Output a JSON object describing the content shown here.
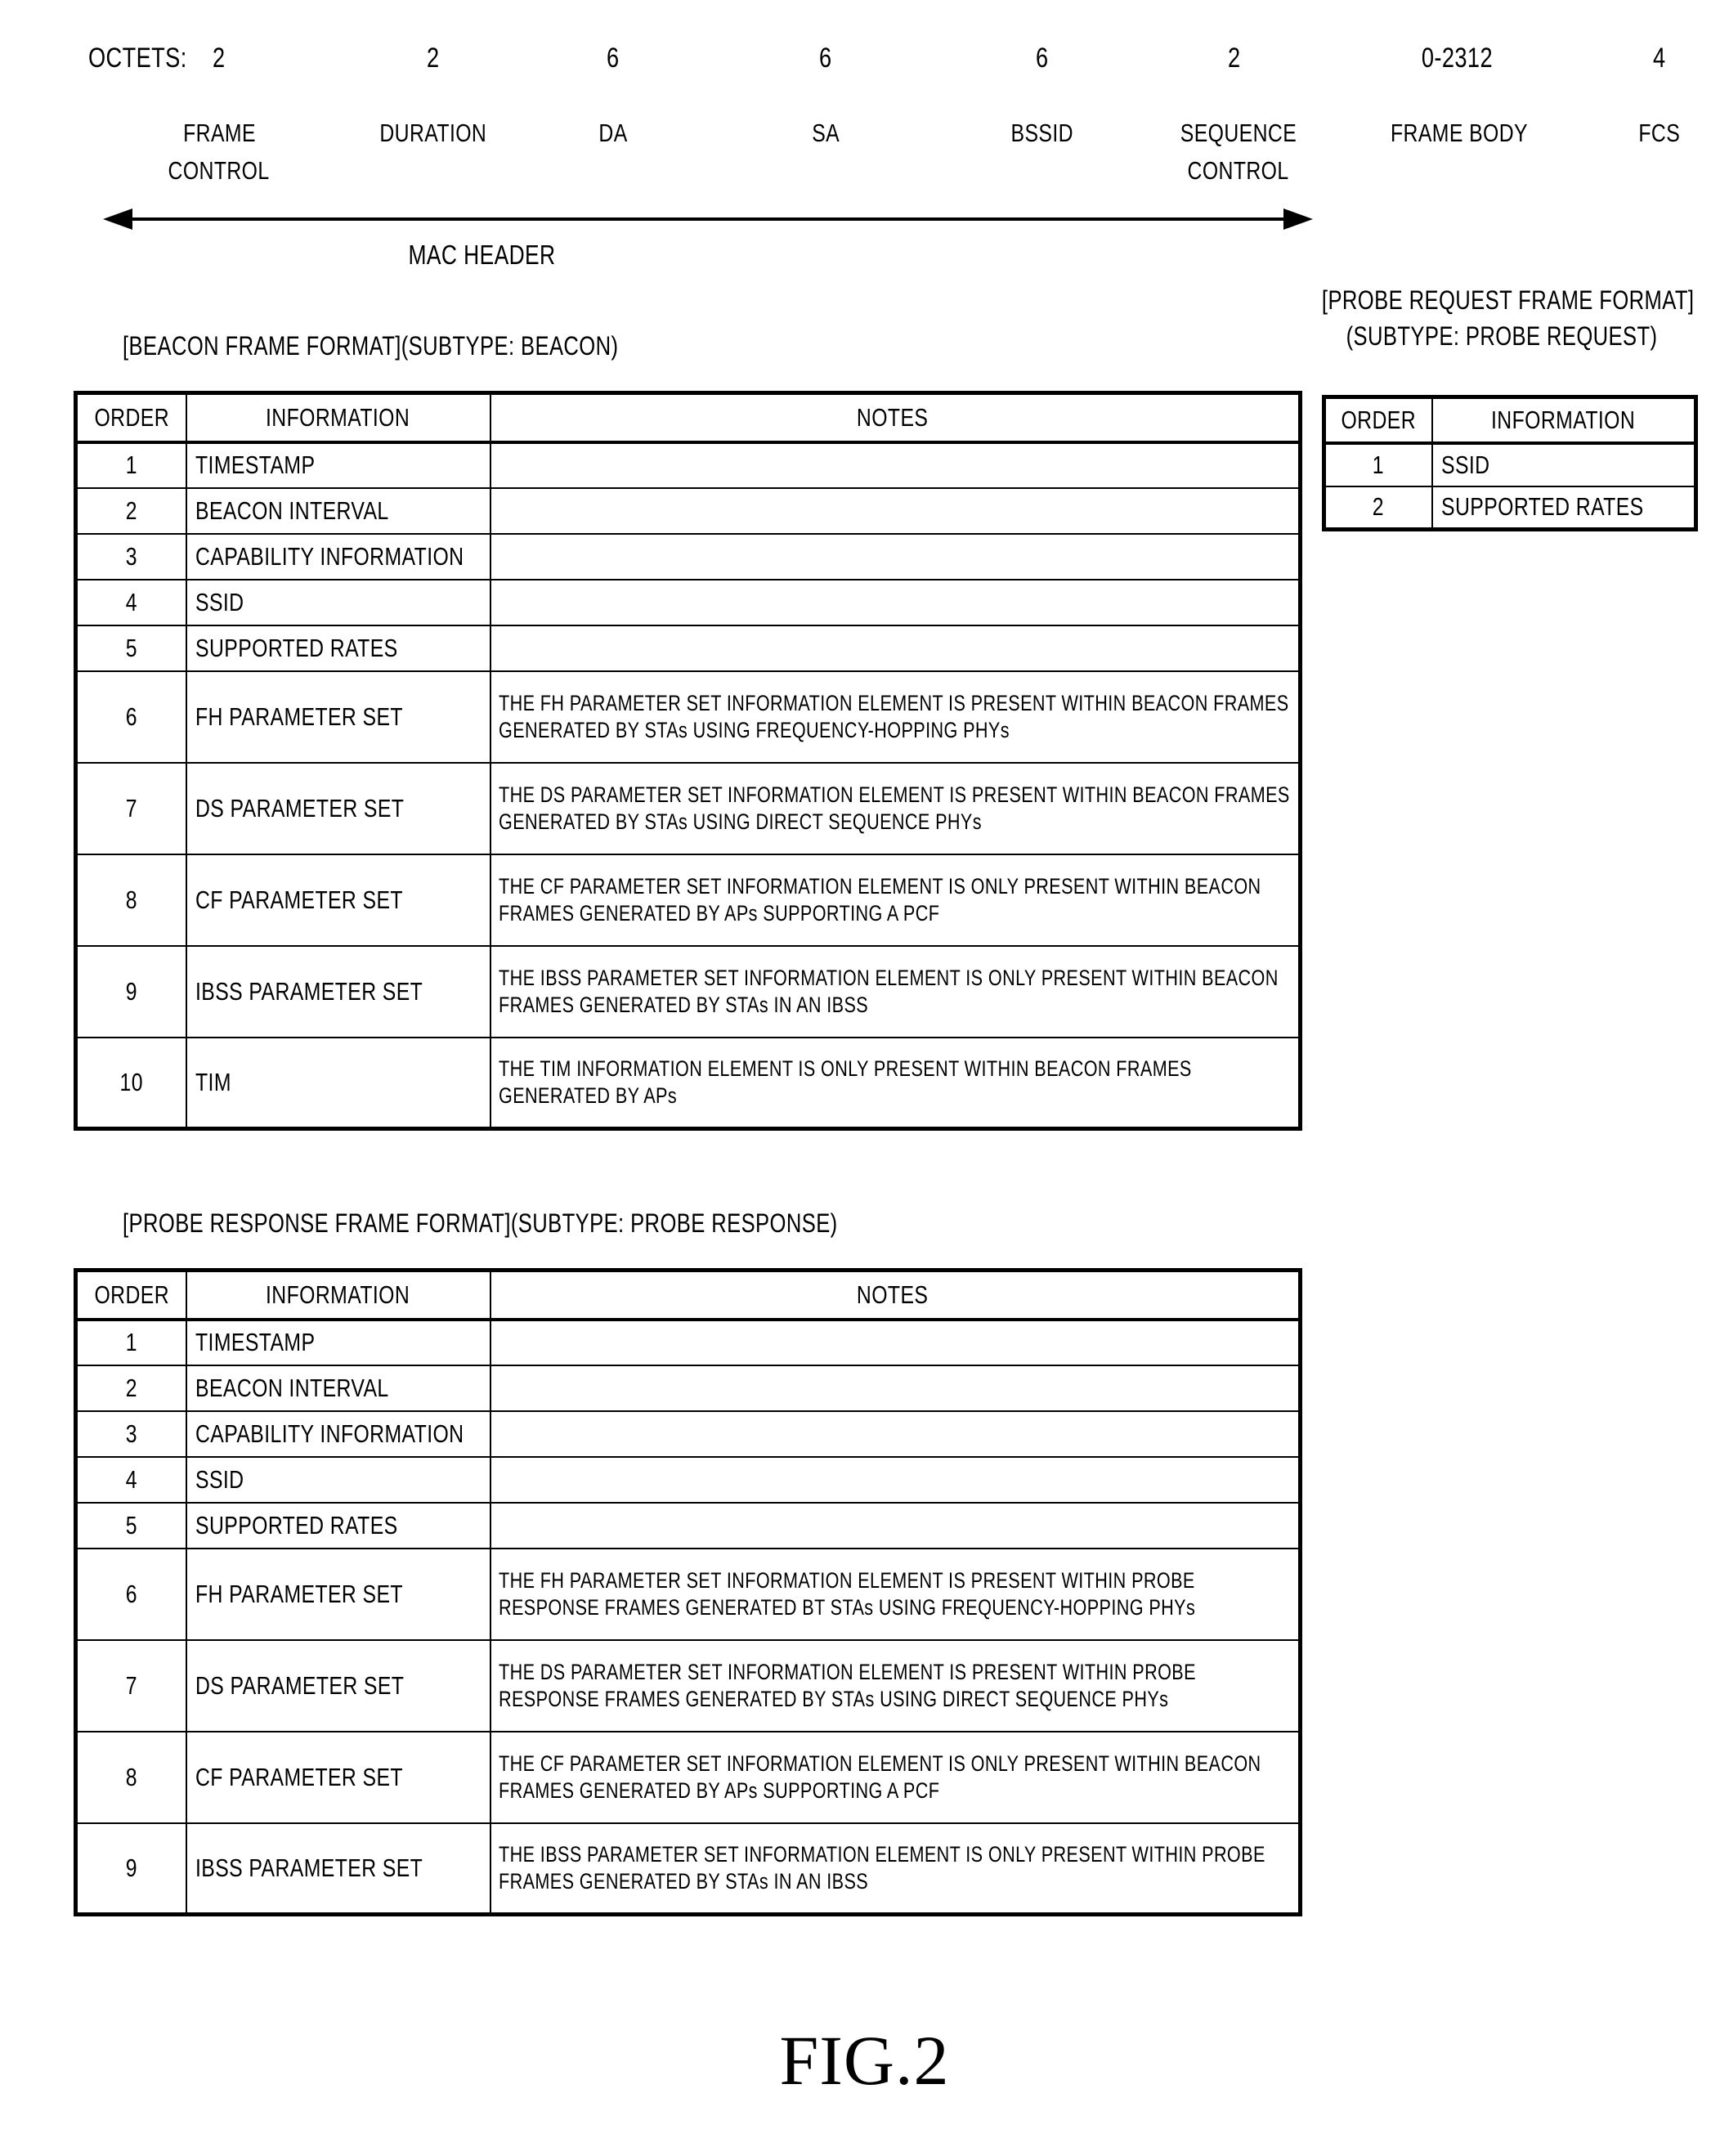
{
  "mac_header": {
    "octets_label": "OCTETS:",
    "fields": [
      {
        "octets": "2",
        "name": "FRAME\nCONTROL"
      },
      {
        "octets": "2",
        "name": "DURATION"
      },
      {
        "octets": "6",
        "name": "DA"
      },
      {
        "octets": "6",
        "name": "SA"
      },
      {
        "octets": "6",
        "name": "BSSID"
      },
      {
        "octets": "2",
        "name": "SEQUENCE\nCONTROL"
      },
      {
        "octets": "0-2312",
        "name": "FRAME BODY"
      },
      {
        "octets": "4",
        "name": "FCS"
      }
    ],
    "span_label": "MAC HEADER"
  },
  "beacon_table": {
    "caption": "[BEACON FRAME FORMAT](SUBTYPE: BEACON)",
    "headers": {
      "order": "ORDER",
      "information": "INFORMATION",
      "notes": "NOTES"
    },
    "rows": [
      {
        "order": "1",
        "information": "TIMESTAMP",
        "notes": ""
      },
      {
        "order": "2",
        "information": "BEACON INTERVAL",
        "notes": ""
      },
      {
        "order": "3",
        "information": "CAPABILITY  INFORMATION",
        "notes": ""
      },
      {
        "order": "4",
        "information": "SSID",
        "notes": ""
      },
      {
        "order": "5",
        "information": "SUPPORTED RATES",
        "notes": ""
      },
      {
        "order": "6",
        "information": "FH PARAMETER SET",
        "notes": "THE FH PARAMETER SET INFORMATION ELEMENT IS PRESENT WITHIN BEACON FRAMES GENERATED BY STAs USING FREQUENCY-HOPPING PHYs"
      },
      {
        "order": "7",
        "information": "DS PARAMETER SET",
        "notes": "THE DS PARAMETER SET INFORMATION ELEMENT IS PRESENT WITHIN BEACON FRAMES GENERATED BY STAs USING DIRECT SEQUENCE PHYs"
      },
      {
        "order": "8",
        "information": "CF PARAMETER SET",
        "notes": "THE CF PARAMETER SET INFORMATION ELEMENT IS ONLY PRESENT WITHIN BEACON FRAMES GENERATED BY APs SUPPORTING A PCF"
      },
      {
        "order": "9",
        "information": "IBSS PARAMETER SET",
        "notes": "THE IBSS PARAMETER SET INFORMATION ELEMENT IS ONLY PRESENT WITHIN BEACON FRAMES GENERATED BY STAs IN AN IBSS"
      },
      {
        "order": "10",
        "information": "TIM",
        "notes": "THE TIM INFORMATION ELEMENT IS ONLY PRESENT WITHIN BEACON FRAMES GENERATED BY APs"
      }
    ]
  },
  "probe_request_table": {
    "caption_line1": "[PROBE REQUEST FRAME FORMAT]",
    "caption_line2": "(SUBTYPE: PROBE REQUEST)",
    "headers": {
      "order": "ORDER",
      "information": "INFORMATION"
    },
    "rows": [
      {
        "order": "1",
        "information": "SSID"
      },
      {
        "order": "2",
        "information": "SUPPORTED RATES"
      }
    ]
  },
  "probe_response_table": {
    "caption": "[PROBE RESPONSE FRAME FORMAT](SUBTYPE: PROBE RESPONSE)",
    "headers": {
      "order": "ORDER",
      "information": "INFORMATION",
      "notes": "NOTES"
    },
    "rows": [
      {
        "order": "1",
        "information": "TIMESTAMP",
        "notes": ""
      },
      {
        "order": "2",
        "information": "BEACON  INTERVAL",
        "notes": ""
      },
      {
        "order": "3",
        "information": "CAPABILITY  INFORMATION",
        "notes": ""
      },
      {
        "order": "4",
        "information": "SSID",
        "notes": ""
      },
      {
        "order": "5",
        "information": "SUPPORTED  RATES",
        "notes": ""
      },
      {
        "order": "6",
        "information": "FH PARAMETER SET",
        "notes": "THE FH PARAMETER SET INFORMATION ELEMENT IS PRESENT WITHIN PROBE RESPONSE FRAMES GENERATED BT STAs USING FREQUENCY-HOPPING PHYs"
      },
      {
        "order": "7",
        "information": "DS PARAMETER SET",
        "notes": "THE DS PARAMETER SET INFORMATION ELEMENT IS PRESENT WITHIN PROBE RESPONSE FRAMES GENERATED BY STAs USING DIRECT SEQUENCE PHYs"
      },
      {
        "order": "8",
        "information": "CF PARAMETER SET",
        "notes": "THE CF PARAMETER SET INFORMATION ELEMENT IS ONLY PRESENT WITHIN BEACON FRAMES GENERATED BY APs SUPPORTING A PCF"
      },
      {
        "order": "9",
        "information": "IBSS PARAMETER SET",
        "notes": "THE IBSS PARAMETER SET INFORMATION ELEMENT IS ONLY PRESENT WITHIN PROBE FRAMES GENERATED BY STAs IN AN IBSS"
      }
    ]
  },
  "figure_label": "FIG.2"
}
